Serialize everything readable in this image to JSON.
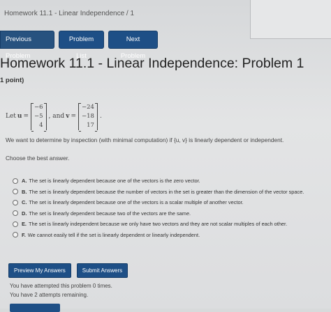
{
  "breadcrumb": "Homework 11.1 - Linear Independence  /  1",
  "nav": {
    "previous": "Previous Problem",
    "list": "Problem List",
    "next": "Next Problem"
  },
  "title": "Homework 11.1 - Linear Independence: Problem 1",
  "points": "1 point)",
  "problem": {
    "let_prefix": "Let",
    "u_label": "u",
    "v_label": "v",
    "equals": "=",
    "and_text": ", and",
    "u_values": [
      "−6",
      "−5",
      "4"
    ],
    "v_values": [
      "−24",
      "−18",
      "17"
    ],
    "period": ".",
    "question": "We want to determine by inspection (with minimal computation) if {u, v} is linearly dependent or independent.",
    "choose": "Choose the best answer."
  },
  "options": [
    {
      "letter": "A.",
      "text": "The set is linearly dependent because one of the vectors is the zero vector."
    },
    {
      "letter": "B.",
      "text": "The set is linearly dependent because the number of vectors in the set is greater than the dimension of the vector space."
    },
    {
      "letter": "C.",
      "text": "The set is linearly dependent because one of the vectors is a scalar multiple of another vector."
    },
    {
      "letter": "D.",
      "text": "The set is linearly dependent because two of the vectors are the same."
    },
    {
      "letter": "E.",
      "text": "The set is linearly independent because we only have two vectors and they are not scalar multiples of each other."
    },
    {
      "letter": "F.",
      "text": "We cannot easily tell if the set is linearly dependent or linearly independent."
    }
  ],
  "actions": {
    "preview": "Preview My Answers",
    "submit": "Submit Answers"
  },
  "status": {
    "attempted": "You have attempted this problem 0 times.",
    "remaining": "You have 2 attempts remaining."
  }
}
